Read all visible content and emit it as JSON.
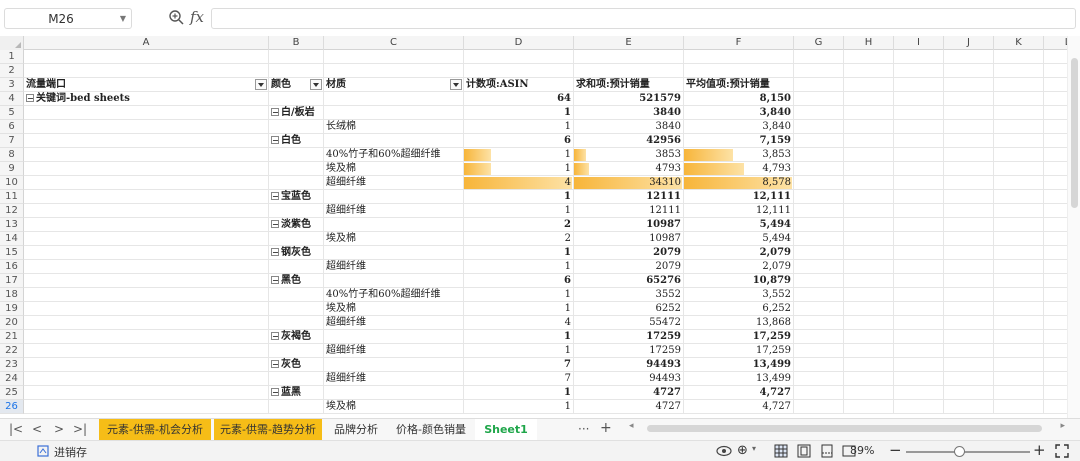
{
  "formula_bar": {
    "cell_ref": "M26",
    "fx_label": "fx",
    "formula": ""
  },
  "columns": [
    "A",
    "B",
    "C",
    "D",
    "E",
    "F",
    "G",
    "H",
    "I",
    "J",
    "K",
    "L"
  ],
  "rows": [
    {
      "n": "1",
      "cells": {}
    },
    {
      "n": "2",
      "cells": {}
    },
    {
      "n": "3",
      "cells": {
        "A": "流量端口",
        "B": "颜色",
        "C": "材质",
        "D": "计数项:ASIN",
        "E": "求和项:预计销量",
        "F": "平均值项:预计销量"
      }
    },
    {
      "n": "4",
      "cells": {
        "A": "关键词-bed sheets",
        "D": "64",
        "E": "521579",
        "F": "8,150"
      }
    },
    {
      "n": "5",
      "cells": {
        "B": "白/板岩",
        "D": "1",
        "E": "3840",
        "F": "3,840"
      }
    },
    {
      "n": "6",
      "cells": {
        "C": "长绒棉",
        "D": "1",
        "E": "3840",
        "F": "3,840"
      }
    },
    {
      "n": "7",
      "cells": {
        "B": "白色",
        "D": "6",
        "E": "42956",
        "F": "7,159"
      }
    },
    {
      "n": "8",
      "cells": {
        "C": "40%竹子和60%超细纤维",
        "D": "1",
        "E": "3853",
        "F": "3,853"
      }
    },
    {
      "n": "9",
      "cells": {
        "C": "埃及棉",
        "D": "1",
        "E": "4793",
        "F": "4,793"
      }
    },
    {
      "n": "10",
      "cells": {
        "C": "超细纤维",
        "D": "4",
        "E": "34310",
        "F": "8,578"
      }
    },
    {
      "n": "11",
      "cells": {
        "B": "宝蓝色",
        "D": "1",
        "E": "12111",
        "F": "12,111"
      }
    },
    {
      "n": "12",
      "cells": {
        "C": "超细纤维",
        "D": "1",
        "E": "12111",
        "F": "12,111"
      }
    },
    {
      "n": "13",
      "cells": {
        "B": "淡紫色",
        "D": "2",
        "E": "10987",
        "F": "5,494"
      }
    },
    {
      "n": "14",
      "cells": {
        "C": "埃及棉",
        "D": "2",
        "E": "10987",
        "F": "5,494"
      }
    },
    {
      "n": "15",
      "cells": {
        "B": "钢灰色",
        "D": "1",
        "E": "2079",
        "F": "2,079"
      }
    },
    {
      "n": "16",
      "cells": {
        "C": "超细纤维",
        "D": "1",
        "E": "2079",
        "F": "2,079"
      }
    },
    {
      "n": "17",
      "cells": {
        "B": "黑色",
        "D": "6",
        "E": "65276",
        "F": "10,879"
      }
    },
    {
      "n": "18",
      "cells": {
        "C": "40%竹子和60%超细纤维",
        "D": "1",
        "E": "3552",
        "F": "3,552"
      }
    },
    {
      "n": "19",
      "cells": {
        "C": "埃及棉",
        "D": "1",
        "E": "6252",
        "F": "6,252"
      }
    },
    {
      "n": "20",
      "cells": {
        "C": "超细纤维",
        "D": "4",
        "E": "55472",
        "F": "13,868"
      }
    },
    {
      "n": "21",
      "cells": {
        "B": "灰褐色",
        "D": "1",
        "E": "17259",
        "F": "17,259"
      }
    },
    {
      "n": "22",
      "cells": {
        "C": "超细纤维",
        "D": "1",
        "E": "17259",
        "F": "17,259"
      }
    },
    {
      "n": "23",
      "cells": {
        "B": "灰色",
        "D": "7",
        "E": "94493",
        "F": "13,499"
      }
    },
    {
      "n": "24",
      "cells": {
        "C": "超细纤维",
        "D": "7",
        "E": "94493",
        "F": "13,499"
      }
    },
    {
      "n": "25",
      "cells": {
        "B": "蓝黑",
        "D": "1",
        "E": "4727",
        "F": "4,727"
      }
    },
    {
      "n": "26",
      "cells": {
        "C": "埃及棉",
        "D": "1",
        "E": "4727",
        "F": "4,727"
      }
    }
  ],
  "data_bars": [
    {
      "row": "8",
      "D": 0.25,
      "E": 0.11,
      "F": 0.45
    },
    {
      "row": "9",
      "D": 0.25,
      "E": 0.14,
      "F": 0.56
    },
    {
      "row": "10",
      "D": 1.0,
      "E": 1.0,
      "F": 1.0
    }
  ],
  "sheet_tabs": [
    {
      "label": "元素-供需-机会分析",
      "style": "yellow"
    },
    {
      "label": "元素-供需-趋势分析",
      "style": "yellow"
    },
    {
      "label": "品牌分析",
      "style": "plain"
    },
    {
      "label": "价格-颜色销量",
      "style": "plain"
    },
    {
      "label": "Sheet1",
      "style": "active"
    }
  ],
  "tab_more": "···",
  "tab_add": "+",
  "status": {
    "macro_label": "进销存",
    "zoom": "89%"
  }
}
